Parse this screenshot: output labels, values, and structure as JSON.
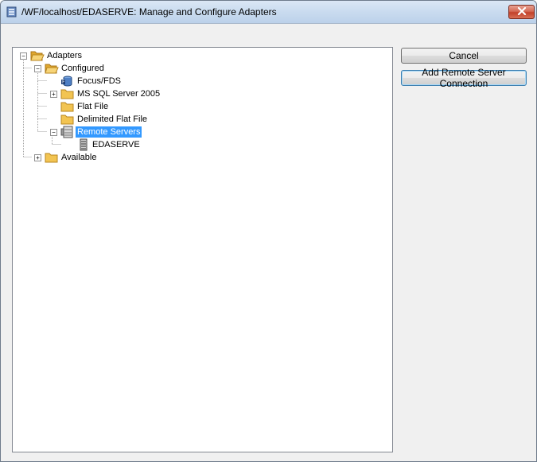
{
  "window": {
    "title": "/WF/localhost/EDASERVE: Manage and Configure Adapters",
    "icon": "server-window-icon",
    "close_icon": "close-icon"
  },
  "buttons": {
    "cancel": "Cancel",
    "add_remote": "Add Remote Server Connection"
  },
  "tree": {
    "root": "Adapters",
    "configured": "Configured",
    "focus_fds": "Focus/FDS",
    "ms_sql": "MS SQL Server 2005",
    "flat_file": "Flat File",
    "delimited_flat_file": "Delimited Flat File",
    "remote_servers": "Remote Servers",
    "edaserve": "EDASERVE",
    "available": "Available",
    "selected": "Remote Servers"
  },
  "colors": {
    "selection": "#3399ff",
    "close_button": "#c2412a",
    "folder": "#f2c452"
  }
}
